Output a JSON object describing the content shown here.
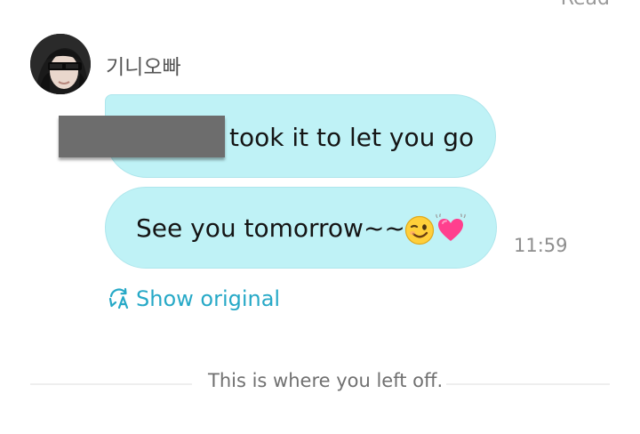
{
  "header": {
    "read_status": "Read"
  },
  "message_group": {
    "sender_name": "기니오빠",
    "messages": [
      {
        "text": "took it to let you go"
      },
      {
        "text": "See you tomorrow~~~"
      }
    ],
    "time": "11:59",
    "show_original_label": "Show original"
  },
  "divider": {
    "label": "This is where you left off."
  },
  "colors": {
    "bubble": "#bff2f6",
    "accent": "#27a9c7"
  },
  "icons": {
    "translate": "translate-icon",
    "wink_emoji": "winking-face-icon",
    "heart_emoji": "beating-heart-icon"
  }
}
